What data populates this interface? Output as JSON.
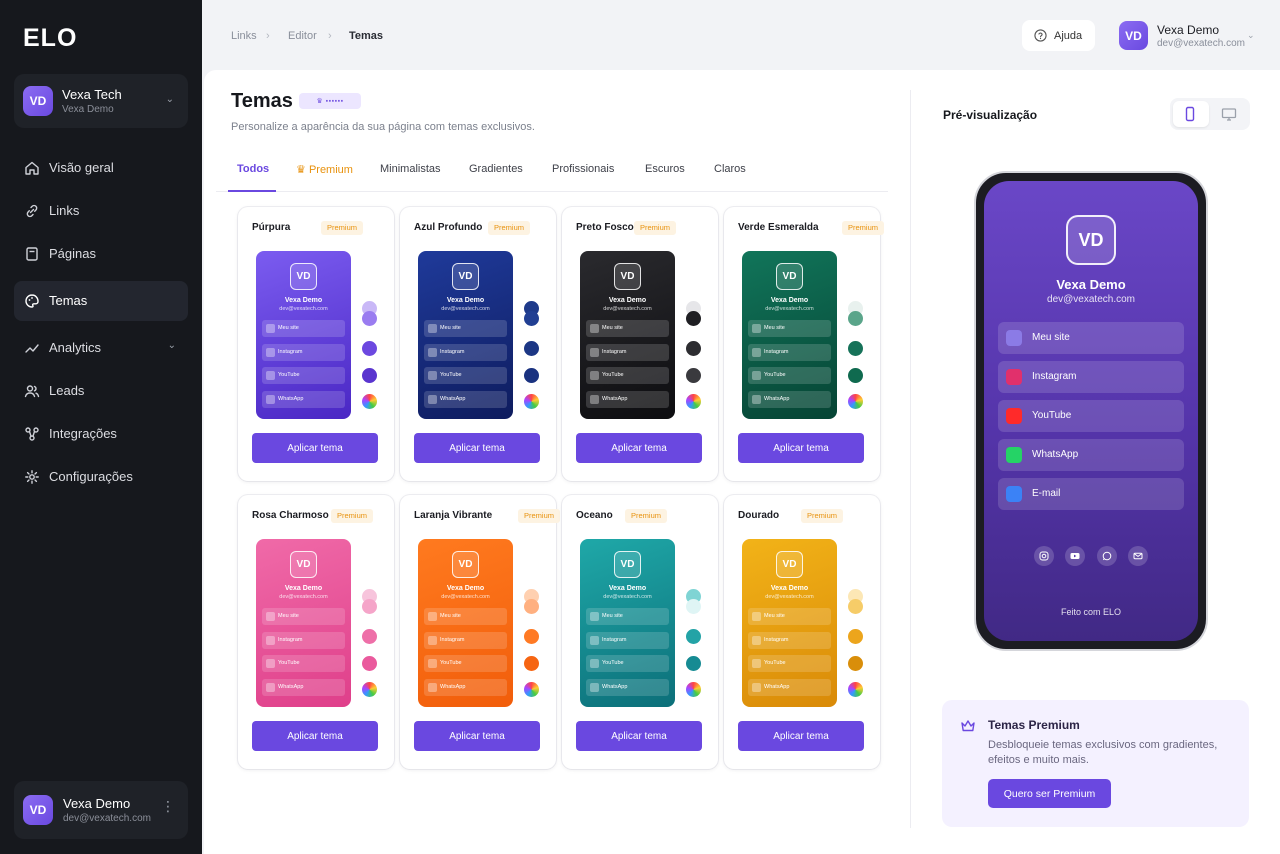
{
  "sidebar": {
    "logo": "ELO",
    "workspace": {
      "initials": "VD",
      "name": "Vexa Tech",
      "sub": "Vexa Demo"
    },
    "nav": [
      {
        "label": "Visão geral",
        "icon": "home-icon"
      },
      {
        "label": "Links",
        "icon": "link-icon"
      },
      {
        "label": "Páginas",
        "icon": "page-icon"
      },
      {
        "label": "Temas",
        "icon": "palette-icon",
        "active": true
      },
      {
        "label": "Analytics",
        "icon": "chart-icon",
        "expandable": true
      },
      {
        "label": "Leads",
        "icon": "users-icon"
      },
      {
        "label": "Integrações",
        "icon": "plug-icon"
      },
      {
        "label": "Configurações",
        "icon": "gear-icon"
      }
    ],
    "account": {
      "initials": "VD",
      "name": "Vexa Demo",
      "email": "dev@vexatech.com"
    }
  },
  "topbar": {
    "breadcrumb": [
      "Links",
      "Editor",
      "Temas"
    ],
    "help": "Ajuda",
    "user": {
      "initials": "VD",
      "name": "Vexa Demo",
      "email": "dev@vexatech.com"
    }
  },
  "page": {
    "title": "Temas",
    "subtitle": "Personalize a aparência da sua página com temas exclusivos.",
    "tabs": [
      "Todos",
      "Premium",
      "Minimalistas",
      "Gradientes",
      "Profissionais",
      "Escuros",
      "Claros"
    ],
    "active_tab": "Todos"
  },
  "themes": [
    {
      "name": "Púrpura",
      "badge": "Premium",
      "colors": [
        "#7b5cf0",
        "#4a27c4"
      ],
      "swatches": [
        "#c9b8f7",
        "#9a7cf0",
        "#6c48e0",
        "#5a35cf"
      ]
    },
    {
      "name": "Azul Profundo",
      "badge": "Premium",
      "colors": [
        "#1f3a9a",
        "#0e1c5e"
      ],
      "swatches": [
        "#1e3a8a",
        "#213f93",
        "#1c3785",
        "#1a3280"
      ]
    },
    {
      "name": "Preto Fosco",
      "badge": "Premium",
      "colors": [
        "#2a2a2e",
        "#0d0d10"
      ],
      "swatches": [
        "#e6e6e9",
        "#1f1f23",
        "#2d2d31",
        "#3a3a3e"
      ]
    },
    {
      "name": "Verde Esmeralda",
      "badge": "Premium",
      "colors": [
        "#11755a",
        "#064434"
      ],
      "swatches": [
        "#e8f1ee",
        "#5aa58a",
        "#167259",
        "#0f6a4f"
      ]
    },
    {
      "name": "Rosa Charmoso",
      "badge": "Premium",
      "colors": [
        "#f06aa8",
        "#df3f8a"
      ],
      "swatches": [
        "#f7c4dc",
        "#f5a5c9",
        "#ee6fa8",
        "#ea5a9d"
      ]
    },
    {
      "name": "Laranja Vibrante",
      "badge": "Premium",
      "colors": [
        "#ff7a1f",
        "#f15d0a"
      ],
      "swatches": [
        "#ffd0b0",
        "#ffb080",
        "#ff7a24",
        "#f66512"
      ]
    },
    {
      "name": "Oceano",
      "badge": "Premium",
      "colors": [
        "#1fa8a8",
        "#0c6f79"
      ],
      "swatches": [
        "#7fd4d4",
        "#dff5f5",
        "#23a3a6",
        "#168b93"
      ]
    },
    {
      "name": "Dourado",
      "badge": "Premium",
      "colors": [
        "#f2b318",
        "#d98a08"
      ],
      "swatches": [
        "#fce7b5",
        "#f6cc68",
        "#eca51c",
        "#d98e0a"
      ]
    }
  ],
  "mini": {
    "initials": "VD",
    "name": "Vexa Demo",
    "email": "dev@vexatech.com",
    "links": [
      "Meu site",
      "Instagram",
      "YouTube",
      "WhatsApp"
    ]
  },
  "apply_label": "Aplicar tema",
  "preview": {
    "title": "Pré-visualização",
    "initials": "VD",
    "name": "Vexa Demo",
    "email": "dev@vexatech.com",
    "links": [
      {
        "label": "Meu site",
        "icon": "link-icon",
        "color": "#8b7be6"
      },
      {
        "label": "Instagram",
        "icon": "instagram-icon",
        "color": "#e1306c"
      },
      {
        "label": "YouTube",
        "icon": "youtube-icon",
        "color": "#ff2a2a"
      },
      {
        "label": "WhatsApp",
        "icon": "whatsapp-icon",
        "color": "#25d366"
      },
      {
        "label": "E-mail",
        "icon": "mail-icon",
        "color": "#3b82f6"
      }
    ],
    "footer": "Feito com ELO"
  },
  "premium_card": {
    "title": "Temas Premium",
    "desc": "Desbloqueie temas exclusivos com gradientes, efeitos e muito mais.",
    "button": "Quero ser Premium"
  },
  "colors": {
    "accent": "#6a48e0",
    "premium": "#e8920e",
    "sidebar": "#16181d"
  }
}
